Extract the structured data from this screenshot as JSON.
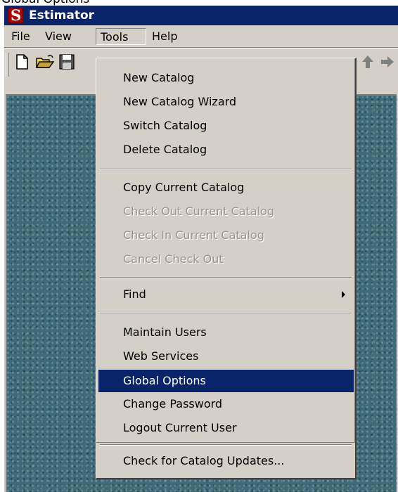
{
  "page_header": {
    "text": "Global Options"
  },
  "window": {
    "title": "Estimator",
    "icon": "estimator-app-icon"
  },
  "menubar": {
    "items": [
      {
        "label": "File"
      },
      {
        "label": "View"
      },
      {
        "label": "Tools",
        "open": true
      },
      {
        "label": "Help"
      }
    ]
  },
  "toolbar": {
    "buttons": [
      {
        "icon": "new-document-icon"
      },
      {
        "icon": "open-folder-icon"
      },
      {
        "icon": "save-icon"
      },
      {
        "icon": "up-arrow-icon"
      },
      {
        "icon": "forward-arrow-icon"
      }
    ]
  },
  "tools_menu": {
    "items": [
      {
        "label": "New Catalog",
        "enabled": true
      },
      {
        "label": "New Catalog Wizard",
        "enabled": true
      },
      {
        "label": "Switch Catalog",
        "enabled": true
      },
      {
        "label": "Delete Catalog",
        "enabled": true
      },
      {
        "label": "Copy Current Catalog",
        "enabled": true
      },
      {
        "label": "Check Out Current Catalog",
        "enabled": false
      },
      {
        "label": "Check In Current Catalog",
        "enabled": false
      },
      {
        "label": "Cancel Check Out",
        "enabled": false
      },
      {
        "label": "Find",
        "enabled": true,
        "has_submenu": true
      },
      {
        "label": "Maintain Users",
        "enabled": true
      },
      {
        "label": "Web Services",
        "enabled": true
      },
      {
        "label": "Global Options",
        "enabled": true,
        "highlighted": true
      },
      {
        "label": "Change Password",
        "enabled": true
      },
      {
        "label": "Logout Current User",
        "enabled": true
      },
      {
        "label": "Check for Catalog Updates...",
        "enabled": true
      }
    ]
  },
  "colors": {
    "title_bar": "#0a246a",
    "menu_face": "#d4d0c8",
    "highlight": "#0a246a",
    "workspace": "#3f6b78",
    "disabled_text": "#9a968e"
  }
}
